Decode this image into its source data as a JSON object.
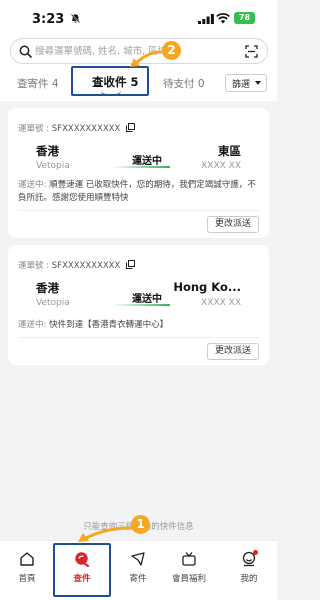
{
  "status_bar": {
    "time": "3:23",
    "battery": "78"
  },
  "search": {
    "placeholder": "搜尋運單號碼, 姓名, 城市, 區域"
  },
  "tabs": [
    {
      "label": "查寄件 4"
    },
    {
      "label": "查收件 5"
    },
    {
      "label": "待支付 0"
    }
  ],
  "filter_label": "篩選",
  "annotations": {
    "marker_1": "1",
    "marker_2": "2"
  },
  "shipments": [
    {
      "waybill_label": "運單號 :",
      "waybill": "SFXXXXXXXXXX",
      "origin_city": "香港",
      "origin_sub": "Vetopia",
      "status": "運送中",
      "dest_city": "東區",
      "dest_sub": "XXXX XX",
      "desc_label": "運送中:",
      "desc": "順豐速運 已收取快件，您的期待，我們定竭誠守護，不負所託。感謝您使用順豐特快",
      "action": "更改派送"
    },
    {
      "waybill_label": "運單號 :",
      "waybill": "SFXXXXXXXXXX",
      "origin_city": "香港",
      "origin_sub": "Vetopia",
      "status": "運送中",
      "dest_city": "Hong Ko...",
      "dest_sub": "XXXX XX",
      "desc_label": "運送中:",
      "desc": "快件到達【香港青衣轉運中心】",
      "action": "更改派送"
    }
  ],
  "footnote": "只能查詢三個月內的快件信息",
  "bottom_nav": [
    {
      "label": "首頁",
      "icon": "home-icon"
    },
    {
      "label": "查件",
      "icon": "search-package-icon"
    },
    {
      "label": "寄件",
      "icon": "send-icon"
    },
    {
      "label": "會員福利",
      "icon": "tv-gift-icon"
    },
    {
      "label": "我的",
      "icon": "profile-icon"
    }
  ],
  "colors": {
    "accent_red": "#d6262c",
    "status_green": "#2eb55c",
    "annotation_blue": "#1d4f9a",
    "annotation_orange": "#f5a623"
  }
}
